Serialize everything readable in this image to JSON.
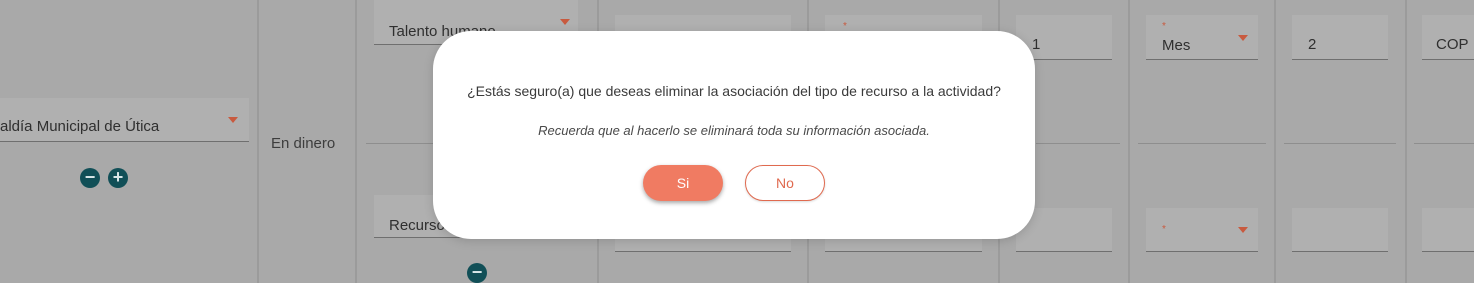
{
  "background": {
    "entity_select": "aldía Municipal de Útica",
    "resource_type_label": "En dinero",
    "resource_select_top": "Talento humano",
    "resource_select_bottom": "Recurso",
    "quantity_value": "1",
    "period_select": "Mes",
    "duration_value": "2",
    "currency_value": "COP",
    "required_mark": "*"
  },
  "dialog": {
    "question": "¿Estás seguro(a) que deseas eliminar la asociación del tipo de recurso a la actividad?",
    "note": "Recuerda que al hacerlo se eliminará toda su información asociada.",
    "yes_label": "Si",
    "no_label": "No"
  },
  "colors": {
    "accent": "#f07b62",
    "accent_dark": "#e06a4f",
    "icon_dark": "#114f57"
  }
}
